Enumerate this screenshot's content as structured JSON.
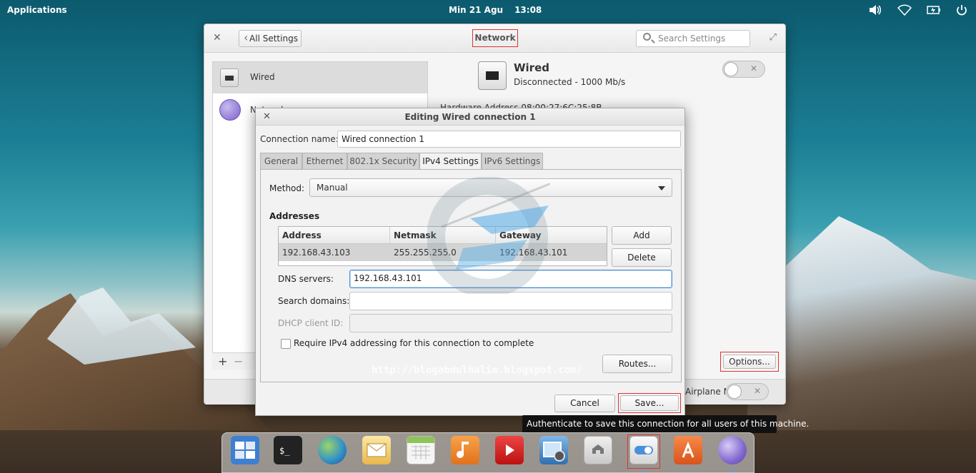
{
  "top_panel": {
    "applications": "Applications",
    "date": "Min 21 Agu",
    "time": "13:08",
    "tray_icons": [
      "volume-icon",
      "wifi-icon",
      "battery-icon",
      "power-icon"
    ]
  },
  "settings": {
    "back_button": "All Settings",
    "title": "Network",
    "search_placeholder": "Search Settings",
    "sidebar": [
      {
        "label": "Wired",
        "icon": "ethernet-icon",
        "selected": true
      },
      {
        "label": "Network proxy",
        "icon": "globe-icon",
        "selected": false
      }
    ],
    "add_symbol": "+",
    "remove_symbol": "−",
    "device": {
      "title": "Wired",
      "status": "Disconnected - 1000 Mb/s",
      "hardware_address": "Hardware Address  08:00:27:6C:25:8B",
      "enabled": false
    },
    "options_button": "Options...",
    "airplane_label": "Airplane Mode",
    "airplane_enabled": false
  },
  "dialog": {
    "title": "Editing Wired connection 1",
    "connection_name_label": "Connection name:",
    "connection_name": "Wired connection 1",
    "tabs": [
      "General",
      "Ethernet",
      "802.1x Security",
      "IPv4 Settings",
      "IPv6 Settings"
    ],
    "active_tab": "IPv4 Settings",
    "method_label": "Method:",
    "method_value": "Manual",
    "addresses_label": "Addresses",
    "columns": [
      "Address",
      "Netmask",
      "Gateway"
    ],
    "rows": [
      [
        "192.168.43.103",
        "255.255.255.0",
        "192.168.43.101"
      ]
    ],
    "add_button": "Add",
    "delete_button": "Delete",
    "dns_label": "DNS servers:",
    "dns_value": "192.168.43.101",
    "search_domains_label": "Search domains:",
    "search_domains_value": "",
    "dhcp_label": "DHCP client ID:",
    "dhcp_value": "",
    "require_checkbox": "Require IPv4 addressing for this connection to complete",
    "require_checked": false,
    "routes_button": "Routes...",
    "cancel_button": "Cancel",
    "save_button": "Save..."
  },
  "watermark": "http://blogabdulhalim.blogspot.com/",
  "tooltip": "Authenticate to save this connection for all users of this machine.",
  "dock": [
    "multitasking-view-icon",
    "terminal-icon",
    "web-browser-icon",
    "mail-icon",
    "calendar-icon",
    "music-icon",
    "videos-icon",
    "photos-icon",
    "files-icon",
    "system-settings-icon",
    "app-center-icon",
    "network-globe-icon"
  ],
  "colors": {
    "highlight": "#dd3333",
    "focus": "#4a90d9",
    "selection": "#d4d4d4"
  }
}
